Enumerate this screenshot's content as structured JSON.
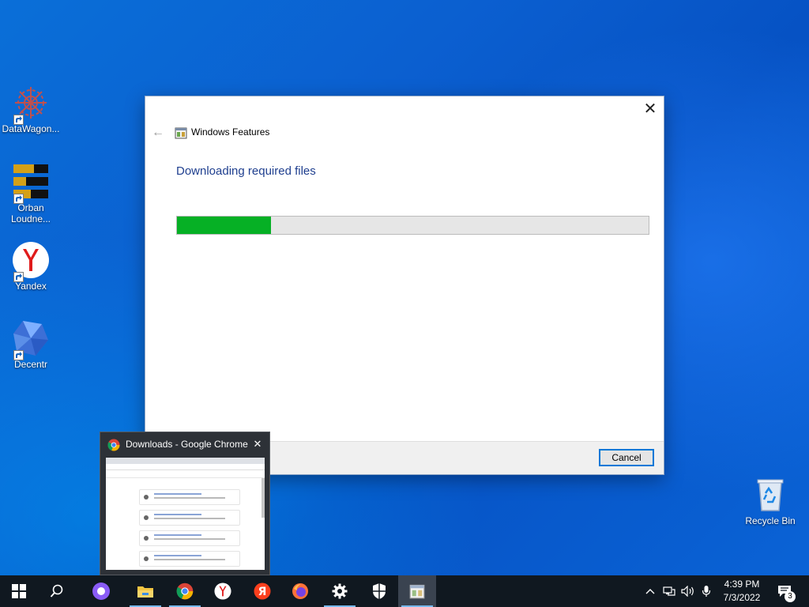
{
  "desktop": {
    "icons": [
      {
        "label": "DataWagon..."
      },
      {
        "label": "Orban\nLoudne..."
      },
      {
        "label": "Yandex"
      },
      {
        "label": "Decentr"
      },
      {
        "label": "Recycle Bin"
      }
    ]
  },
  "dialog": {
    "title": "Windows Features",
    "heading": "Downloading required files",
    "progress_fraction": 0.2,
    "progress_color": "#06b025",
    "cancel_label": "Cancel",
    "close_glyph": "✕",
    "back_glyph": "←"
  },
  "preview": {
    "title": "Downloads - Google Chrome",
    "close_glyph": "✕"
  },
  "taskbar": {
    "apps": [
      "start-icon",
      "search-icon",
      "alice-icon",
      "file-explorer-icon",
      "chrome-icon",
      "yandex-browser-icon",
      "yandex-icon",
      "firefox-icon",
      "settings-icon",
      "security-icon",
      "windows-features-icon"
    ],
    "time": "4:39 PM",
    "date": "7/3/2022",
    "notification_count": "3"
  }
}
